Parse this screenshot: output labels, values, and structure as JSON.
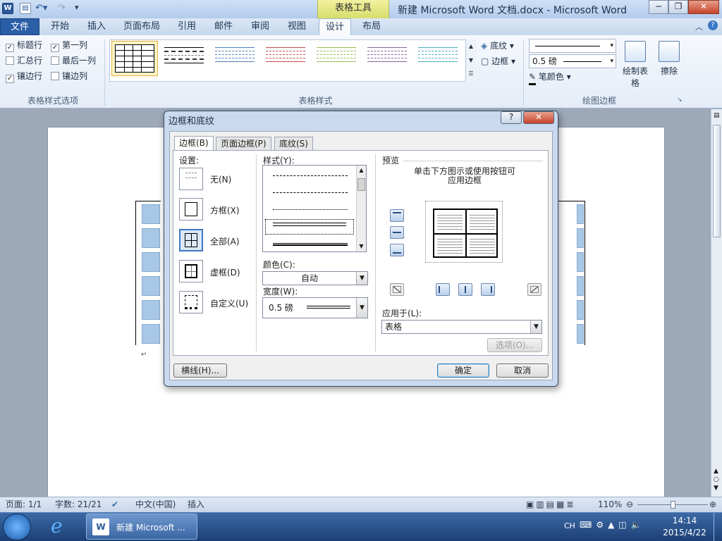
{
  "window": {
    "title": "新建 Microsoft Word 文档.docx - Microsoft Word",
    "minimize": "−",
    "maximize": "❐",
    "close": "✕"
  },
  "ribbon": {
    "context_group": "表格工具",
    "tabs": [
      "文件",
      "开始",
      "插入",
      "页面布局",
      "引用",
      "邮件",
      "审阅",
      "视图",
      "设计",
      "布局"
    ],
    "active_tab": "设计",
    "style_options": {
      "items": [
        {
          "label": "标题行",
          "checked": true
        },
        {
          "label": "第一列",
          "checked": true
        },
        {
          "label": "汇总行",
          "checked": false
        },
        {
          "label": "最后一列",
          "checked": false
        },
        {
          "label": "镶边行",
          "checked": true
        },
        {
          "label": "镶边列",
          "checked": false
        }
      ],
      "group_label": "表格样式选项"
    },
    "table_styles": {
      "group_label": "表格样式",
      "shading": "底纹",
      "borders": "边框"
    },
    "draw_borders": {
      "pen_weight": "0.5 磅",
      "pen_color": "笔颜色",
      "draw_table": "绘制表格",
      "eraser": "擦除",
      "group_label": "绘图边框"
    }
  },
  "dialog": {
    "title": "边框和底纹",
    "help": "?",
    "close": "✕",
    "tabs": [
      "边框(B)",
      "页面边框(P)",
      "底纹(S)"
    ],
    "setting_label": "设置:",
    "settings": [
      {
        "label": "无(N)"
      },
      {
        "label": "方框(X)"
      },
      {
        "label": "全部(A)"
      },
      {
        "label": "虚框(D)"
      },
      {
        "label": "自定义(U)"
      }
    ],
    "selected_setting": "全部(A)",
    "style_label": "样式(Y):",
    "color_label": "颜色(C):",
    "color_value": "自动",
    "width_label": "宽度(W):",
    "width_value": "0.5 磅",
    "preview_label": "预览",
    "preview_hint": "单击下方图示或使用按钮可应用边框",
    "apply_to_label": "应用于(L):",
    "apply_to_value": "表格",
    "options_button": "选项(O)...",
    "horizontal_line_button": "横线(H)...",
    "ok_button": "确定",
    "cancel_button": "取消"
  },
  "statusbar": {
    "page": "页面: 1/1",
    "words": "字数: 21/21",
    "language": "中文(中国)",
    "mode": "插入",
    "zoom": "110%"
  },
  "taskbar": {
    "app_label": "新建 Microsoft ...",
    "ime": "CH",
    "time": "14:14",
    "date": "2015/4/22"
  },
  "colors": {
    "accent": "#2a5ea6",
    "context": "#dfe06f",
    "cell_fill": "#a9c8e6"
  }
}
